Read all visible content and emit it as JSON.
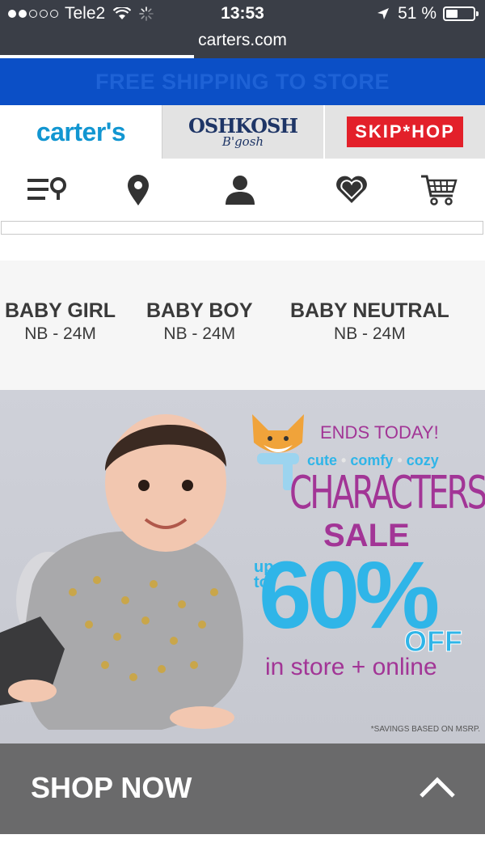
{
  "status_bar": {
    "carrier": "Tele2",
    "time": "13:53",
    "battery": "51 %",
    "battery_level": 0.51
  },
  "browser": {
    "url": "carters.com",
    "load_progress": 0.4
  },
  "promo_banner": {
    "text": "FREE SHIPPING TO STORE"
  },
  "brands": {
    "carters": "carter's",
    "oshkosh_main": "OSHKOSH",
    "oshkosh_sub": "B'gosh",
    "skiphop": "SKIP*HOP"
  },
  "nav_icons": [
    "store-finder-icon",
    "location-pin-icon",
    "account-icon",
    "favorites-heart-icon",
    "shopping-cart-icon"
  ],
  "categories": [
    {
      "name": "BABY GIRL",
      "range": "NB - 24M"
    },
    {
      "name": "BABY BOY",
      "range": "NB - 24M"
    },
    {
      "name": "BABY NEUTRAL",
      "range": "NB - 24M"
    }
  ],
  "hero": {
    "ends": "ENDS TODAY!",
    "tag_1": "cute",
    "tag_2": "comfy",
    "tag_3": "cozy",
    "headline": "CHARACTERS",
    "sale": "SALE",
    "up_to_1": "up",
    "up_to_2": "to",
    "percent": "60%",
    "off": "OFF",
    "where": "in store + online",
    "fine_print": "*SAVINGS BASED ON MSRP."
  },
  "shop_now": {
    "label": "SHOP NOW"
  },
  "colors": {
    "status_bg": "#3a3e47",
    "promo_bg": "#0b4fc6",
    "carters_blue": "#1296d1",
    "oshkosh_navy": "#1e3566",
    "skiphop_red": "#e3202a",
    "sale_purple": "#a23596",
    "sale_blue": "#2fb5e8",
    "shop_bar": "#6a6a6b"
  }
}
